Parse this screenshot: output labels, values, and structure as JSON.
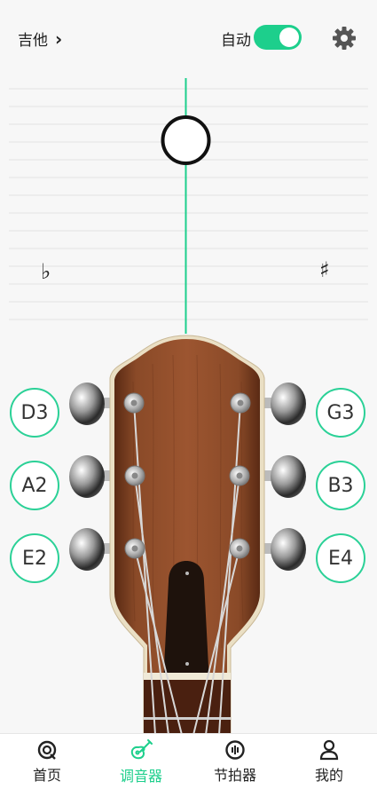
{
  "header": {
    "instrument": "吉他",
    "auto_label": "自动",
    "auto_on": true
  },
  "meter": {
    "flat_symbol": "♭",
    "sharp_symbol": "♯"
  },
  "strings": {
    "left": [
      "D3",
      "A2",
      "E2"
    ],
    "right": [
      "G3",
      "B3",
      "E4"
    ]
  },
  "tabs": [
    {
      "label": "首页",
      "icon": "home-icon",
      "active": false
    },
    {
      "label": "调音器",
      "icon": "guitar-icon",
      "active": true
    },
    {
      "label": "节拍器",
      "icon": "metronome-icon",
      "active": false
    },
    {
      "label": "我的",
      "icon": "profile-icon",
      "active": false
    }
  ],
  "colors": {
    "accent": "#1dcf8c",
    "wood": "#7a3e22"
  }
}
